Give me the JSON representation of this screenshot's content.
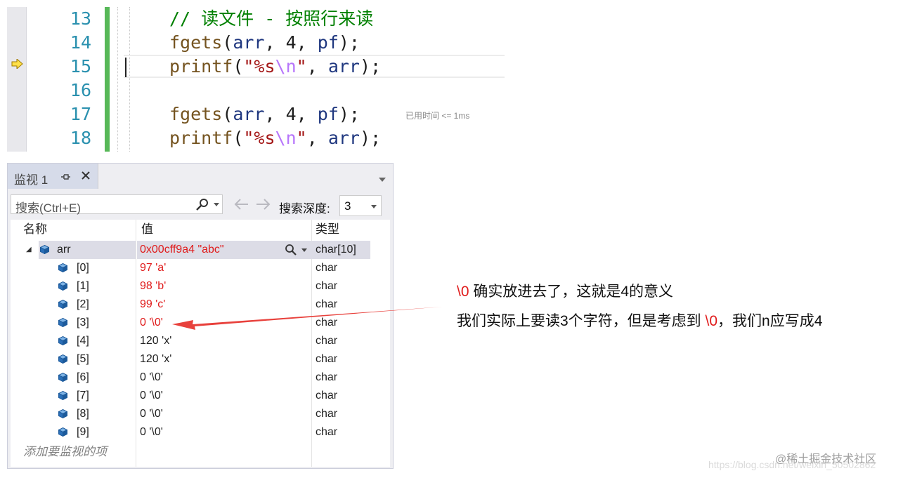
{
  "editor": {
    "lines": [
      {
        "num": "13",
        "comment": "// 读文件 - 按照行来读"
      },
      {
        "num": "14",
        "func": "fgets",
        "p1": "(",
        "var1": "arr",
        "p2": ", ",
        "num_arg": "4",
        "p3": ", ",
        "var2": "pf",
        "p4": ");"
      },
      {
        "num": "15",
        "func": "printf",
        "p1": "(",
        "str_open": "\"%s",
        "esc": "\\n",
        "str_close": "\"",
        "p2": ", ",
        "var1": "arr",
        "p3": ");"
      },
      {
        "num": "16"
      },
      {
        "num": "17",
        "func": "fgets",
        "p1": "(",
        "var1": "arr",
        "p2": ", ",
        "num_arg": "4",
        "p3": ", ",
        "var2": "pf",
        "p4": ");"
      },
      {
        "num": "18",
        "func": "printf",
        "p1": "(",
        "str_open": "\"%s",
        "esc": "\\n",
        "str_close": "\"",
        "p2": ", ",
        "var1": "arr",
        "p3": ");"
      }
    ],
    "elapsed": "已用时间 <= 1ms",
    "current_line": "15"
  },
  "watch": {
    "tab_title": "监视 1",
    "search_placeholder": "搜索(Ctrl+E)",
    "depth_label": "搜索深度:",
    "depth_value": "3",
    "columns": {
      "name": "名称",
      "value": "值",
      "type": "类型"
    },
    "parent": {
      "name": "arr",
      "value": "0x00cff9a4 \"abc\"",
      "type": "char[10]"
    },
    "rows": [
      {
        "name": "[0]",
        "value": "97 'a'",
        "type": "char",
        "changed": true
      },
      {
        "name": "[1]",
        "value": "98 'b'",
        "type": "char",
        "changed": true
      },
      {
        "name": "[2]",
        "value": "99 'c'",
        "type": "char",
        "changed": true
      },
      {
        "name": "[3]",
        "value": "0 '\\0'",
        "type": "char",
        "changed": true
      },
      {
        "name": "[4]",
        "value": "120 'x'",
        "type": "char",
        "changed": false
      },
      {
        "name": "[5]",
        "value": "120 'x'",
        "type": "char",
        "changed": false
      },
      {
        "name": "[6]",
        "value": "0 '\\0'",
        "type": "char",
        "changed": false
      },
      {
        "name": "[7]",
        "value": "0 '\\0'",
        "type": "char",
        "changed": false
      },
      {
        "name": "[8]",
        "value": "0 '\\0'",
        "type": "char",
        "changed": false
      },
      {
        "name": "[9]",
        "value": "0 '\\0'",
        "type": "char",
        "changed": false
      }
    ],
    "add_watch": "添加要监视的项"
  },
  "annotation": {
    "line1_red": "\\0",
    "line1_rest": " 确实放进去了，这就是4的意义",
    "line2_a": "我们实际上要读3个字符，但是考虑到 ",
    "line2_red": "\\0",
    "line2_b": "，我们n应写成4"
  },
  "watermark": {
    "brand": "@稀土掘金技术社区",
    "url": "https://blog.csdn.net/weixin_50502862"
  },
  "colors": {
    "changed_value": "#e01b1b",
    "line_number": "#2b91af",
    "comment": "#008000",
    "change_bar": "#57b858",
    "arrow": "#e8413c"
  }
}
